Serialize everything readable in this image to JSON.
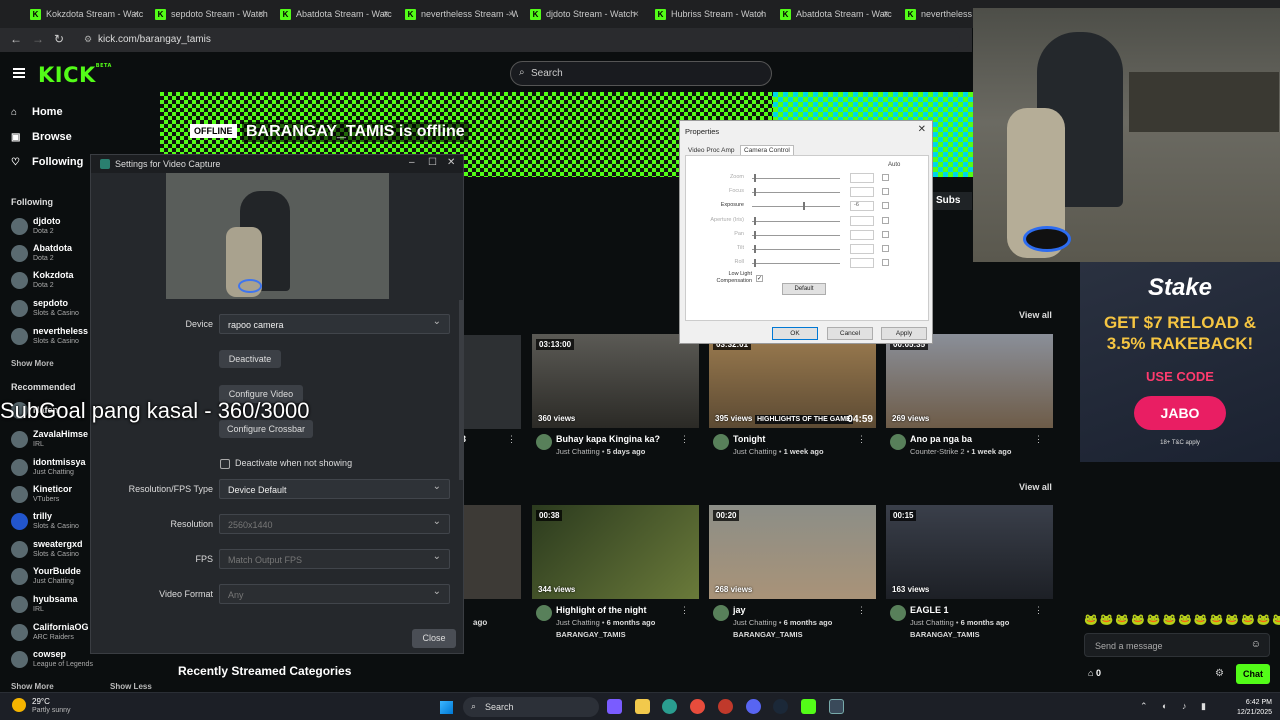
{
  "browser": {
    "tabs": [
      {
        "label": "Kokzdota Stream - Watc"
      },
      {
        "label": "sepdoto Stream - Watch"
      },
      {
        "label": "Abatdota Stream - Watc"
      },
      {
        "label": "nevertheless Stream - W"
      },
      {
        "label": "djdoto Stream - Watch"
      },
      {
        "label": "Hubriss Stream - Watch"
      },
      {
        "label": "Abatdota Stream - Watc"
      },
      {
        "label": "nevertheless Stre"
      }
    ],
    "url": "kick.com/barangay_tamis"
  },
  "header": {
    "logo": "KICK",
    "logo_sup": "BETA",
    "search_placeholder": "Search"
  },
  "sidebar": {
    "nav": [
      {
        "label": "Home",
        "icon": "home-icon"
      },
      {
        "label": "Browse",
        "icon": "browse-icon"
      },
      {
        "label": "Following",
        "icon": "heart-icon"
      }
    ],
    "following_title": "Following",
    "following": [
      {
        "name": "djdoto",
        "category": "Dota 2"
      },
      {
        "name": "Abatdota",
        "category": "Dota 2"
      },
      {
        "name": "Kokzdota",
        "category": "Dota 2"
      },
      {
        "name": "sepdoto",
        "category": "Slots & Casino"
      },
      {
        "name": "nevertheless",
        "category": "Slots & Casino"
      }
    ],
    "show_more": "Show More",
    "recommended_title": "Recommended",
    "recommended": [
      {
        "name": "Hafen",
        "category": ""
      },
      {
        "name": "ZavalaHimse",
        "category": "IRL"
      },
      {
        "name": "idontmissya",
        "category": "Just Chatting"
      },
      {
        "name": "Kineticor",
        "category": "VTubers"
      },
      {
        "name": "trilly",
        "category": "Slots & Casino"
      },
      {
        "name": "sweatergxd",
        "category": "Slots & Casino"
      },
      {
        "name": "YourBudde",
        "category": "Just Chatting"
      },
      {
        "name": "hyubsama",
        "category": "IRL"
      },
      {
        "name": "CaliforniaOG",
        "category": "ARC Raiders"
      },
      {
        "name": "cowsep",
        "category": "League of Legends"
      }
    ],
    "show_more_bottom": "Show More",
    "show_less": "Show Less"
  },
  "banner": {
    "offline_badge": "OFFLINE",
    "title": "BARANGAY_TAMIS is offline",
    "subs_label": "Subs"
  },
  "videos_row1": {
    "view_all": "View all",
    "items": [
      {
        "duration": "03:13:00",
        "views": "360 views",
        "title": "Buhay kapa Kingina ka?",
        "category": "Just Chatting",
        "age": "5 days ago",
        "overlay": ""
      },
      {
        "duration": "03:32:01",
        "views": "395 views",
        "title": "Tonight",
        "category": "Just Chatting",
        "age": "1 week ago",
        "overlay": "HIGHLIGHTS OF THE GAME",
        "time": "04:59"
      },
      {
        "duration": "00:05:35",
        "views": "269 views",
        "title": "Ano pa nga ba",
        "category": "Counter-Strike 2",
        "age": "1 week ago",
        "overlay": ""
      }
    ]
  },
  "videos_row2": {
    "view_all": "View all",
    "items": [
      {
        "duration": "00:38",
        "views": "344 views",
        "title": "Highlight of the night",
        "category": "Just Chatting",
        "age": "6 months ago",
        "channel": "BARANGAY_TAMIS"
      },
      {
        "duration": "00:20",
        "views": "268 views",
        "title": "jay",
        "category": "Just Chatting",
        "age": "6 months ago",
        "channel": "BARANGAY_TAMIS"
      },
      {
        "duration": "00:15",
        "views": "163 views",
        "title": "EAGLE 1",
        "category": "Just Chatting",
        "age": "6 months ago",
        "channel": "BARANGAY_TAMIS"
      }
    ],
    "partial_age": "ago",
    "partial_row1_char": "3"
  },
  "recent_categories_title": "Recently Streamed Categories",
  "settings_dialog": {
    "title": "Settings for Video Capture",
    "device_label": "Device",
    "device_value": "rapoo camera",
    "deactivate_button": "Deactivate",
    "configure_video_button": "Configure Video",
    "configure_crossbar_button": "Configure Crossbar",
    "deactivate_when_hidden_label": "Deactivate when not showing",
    "res_fps_type_label": "Resolution/FPS Type",
    "res_fps_type_value": "Device Default",
    "resolution_label": "Resolution",
    "resolution_value": "2560x1440",
    "fps_label": "FPS",
    "fps_value": "Match Output FPS",
    "video_format_label": "Video Format",
    "video_format_value": "Any",
    "close_button": "Close"
  },
  "overlay_text": "SubGoal pang kasal - 360/3000",
  "properties_dialog": {
    "title": "Properties",
    "tabs": [
      "Video Proc Amp",
      "Camera Control"
    ],
    "auto_label": "Auto",
    "rows": [
      {
        "label": "Zoom",
        "value": "",
        "enabled": false,
        "level": 0.02
      },
      {
        "label": "Focus",
        "value": "",
        "enabled": false,
        "level": 0.02
      },
      {
        "label": "Exposure",
        "value": "-6",
        "enabled": true,
        "level": 0.58
      },
      {
        "label": "Aperture (Iris)",
        "value": "",
        "enabled": false,
        "level": 0.02
      },
      {
        "label": "Pan",
        "value": "",
        "enabled": false,
        "level": 0.02
      },
      {
        "label": "Tilt",
        "value": "",
        "enabled": false,
        "level": 0.02
      },
      {
        "label": "Roll",
        "value": "",
        "enabled": false,
        "level": 0.02
      }
    ],
    "low_light_label": "Low Light Compensation",
    "default_button": "Default",
    "ok_button": "OK",
    "cancel_button": "Cancel",
    "apply_button": "Apply"
  },
  "ad": {
    "brand": "Stake",
    "offer_line1": "GET $7 RELOAD &",
    "offer_line2": "3.5% RAKEBACK!",
    "use_code": "USE CODE",
    "code": "JABO",
    "terms": "18+ T&C apply"
  },
  "chat": {
    "placeholder": "Send a message",
    "points": "0",
    "chat_button": "Chat",
    "emotes": "🐸🐸🐸🐸🐸🐸🐸🐸🐸🐸🐸🐸🐸🐸"
  },
  "taskbar": {
    "temperature": "29°C",
    "weather": "Partly sunny",
    "search": "Search",
    "time": "6:42 PM",
    "date": "12/21/2025"
  }
}
